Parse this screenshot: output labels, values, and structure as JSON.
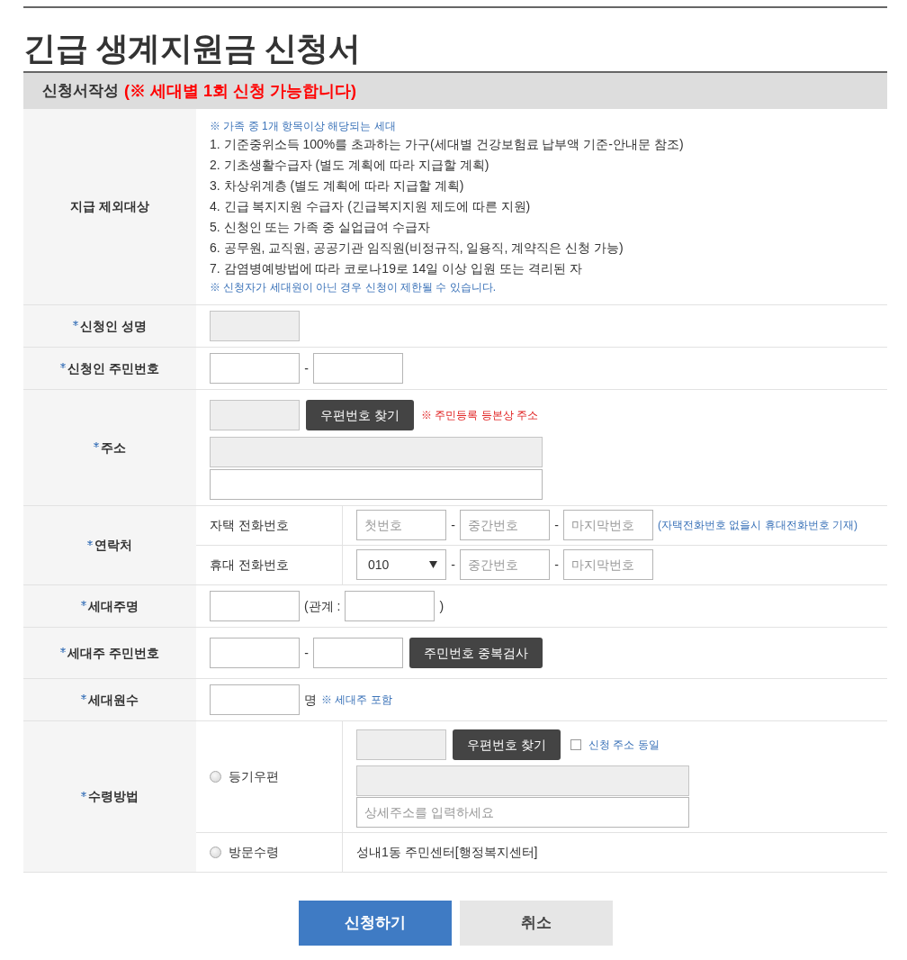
{
  "title": "긴급 생계지원금 신청서",
  "section": {
    "label": "신청서작성",
    "notice": "(※ 세대별 1회 신청 가능합니다)"
  },
  "rows": [
    {
      "label": "지급 제외대상",
      "required": false,
      "kind": "list",
      "intro": "※ 가족 중 1개 항목이상 해당되는 세대",
      "items": [
        "1. 기준중위소득 100%를 초과하는 가구(세대별 건강보험료 납부액 기준-안내문 참조)",
        "2. 기초생활수급자 (별도 계획에 따라 지급할 계획)",
        "3. 차상위계층 (별도 계획에 따라 지급할 계획)",
        "4. 긴급 복지지원 수급자 (긴급복지지원 제도에 따른 지원)",
        "5. 신청인 또는 가족 중 실업급여 수급자",
        "6. 공무원, 교직원, 공공기관 임직원(비정규직, 일용직, 계약직은 신청 가능)",
        "7. 감염병예방법에 따라 코로나19로 14일 이상 입원 또는 격리된 자"
      ],
      "footnote": "※ 신청자가 세대원이 아닌 경우 신청이 제한될 수 있습니다."
    },
    {
      "label": "신청인 성명",
      "required": true,
      "kind": "fields",
      "lines": [
        [
          {
            "kind": "input",
            "disabled": true
          }
        ]
      ]
    },
    {
      "label": "신청인 주민번호",
      "required": true,
      "kind": "fields",
      "lines": [
        [
          {
            "kind": "input",
            "disabled": false
          },
          {
            "kind": "dash",
            "text": "-"
          },
          {
            "kind": "input",
            "disabled": false
          }
        ]
      ]
    },
    {
      "label": "주소",
      "required": true,
      "kind": "fields",
      "lines": [
        [
          {
            "kind": "input",
            "disabled": true
          },
          {
            "kind": "button",
            "text": "우편번호 찾기"
          },
          {
            "kind": "note",
            "text": "※ 주민등록 등본상 주소",
            "color": "#e02020"
          }
        ],
        [
          {
            "kind": "address",
            "disabled": true
          }
        ],
        [
          {
            "kind": "address",
            "disabled": false
          }
        ]
      ]
    },
    {
      "label": "연락처",
      "required": true,
      "kind": "split",
      "subrows": [
        {
          "kind": "label",
          "label": "자택 전화번호",
          "lines": [
            [
              {
                "kind": "input",
                "disabled": false,
                "placeholder": "첫번호"
              },
              {
                "kind": "dash",
                "text": "-"
              },
              {
                "kind": "input",
                "disabled": false,
                "placeholder": "중간번호"
              },
              {
                "kind": "dash",
                "text": "-"
              },
              {
                "kind": "input",
                "disabled": false,
                "placeholder": "마지막번호"
              },
              {
                "kind": "note",
                "text": "(자택전화번호 없을시 휴대전화번호 기재)",
                "color": "#3a72b8"
              }
            ]
          ]
        },
        {
          "kind": "label",
          "label": "휴대 전화번호",
          "lines": [
            [
              {
                "kind": "select",
                "value": "010"
              },
              {
                "kind": "dash",
                "text": "-"
              },
              {
                "kind": "input",
                "disabled": false,
                "placeholder": "중간번호"
              },
              {
                "kind": "dash",
                "text": "-"
              },
              {
                "kind": "input",
                "disabled": false,
                "placeholder": "마지막번호"
              }
            ]
          ]
        }
      ]
    },
    {
      "label": "세대주명",
      "required": true,
      "kind": "fields",
      "lines": [
        [
          {
            "kind": "input",
            "disabled": false
          },
          {
            "kind": "text",
            "text": "(관계 :"
          },
          {
            "kind": "input",
            "disabled": false
          },
          {
            "kind": "text",
            "text": ")"
          }
        ]
      ]
    },
    {
      "label": "세대주 주민번호",
      "required": true,
      "kind": "fields",
      "lines": [
        [
          {
            "kind": "input",
            "disabled": false
          },
          {
            "kind": "dash",
            "text": "-"
          },
          {
            "kind": "input",
            "disabled": false
          },
          {
            "kind": "button",
            "text": "주민번호 중복검사"
          }
        ]
      ]
    },
    {
      "label": "세대원수",
      "required": true,
      "kind": "fields",
      "lines": [
        [
          {
            "kind": "input",
            "disabled": false
          },
          {
            "kind": "text",
            "text": "명"
          },
          {
            "kind": "note",
            "text": "※ 세대주 포함",
            "color": "#3a72b8"
          }
        ]
      ]
    },
    {
      "label": "수령방법",
      "required": true,
      "kind": "split",
      "subrows": [
        {
          "kind": "radio",
          "label": "등기우편",
          "selected": false,
          "lines": [
            [
              {
                "kind": "input",
                "disabled": true
              },
              {
                "kind": "button",
                "text": "우편번호 찾기"
              },
              {
                "kind": "checkbox",
                "checked": false,
                "text": "신청 주소 동일"
              }
            ],
            [
              {
                "kind": "address",
                "disabled": true
              }
            ],
            [
              {
                "kind": "address",
                "disabled": false,
                "placeholder": "상세주소를 입력하세요"
              }
            ]
          ]
        },
        {
          "kind": "radio",
          "label": "방문수령",
          "selected": false,
          "lines": [
            [
              {
                "kind": "text",
                "text": "성내1동 주민센터[행정복지센터]"
              }
            ]
          ]
        }
      ]
    }
  ],
  "buttons": [
    {
      "kind": "primary",
      "label": "신청하기"
    },
    {
      "kind": "secondary",
      "label": "취소"
    }
  ]
}
